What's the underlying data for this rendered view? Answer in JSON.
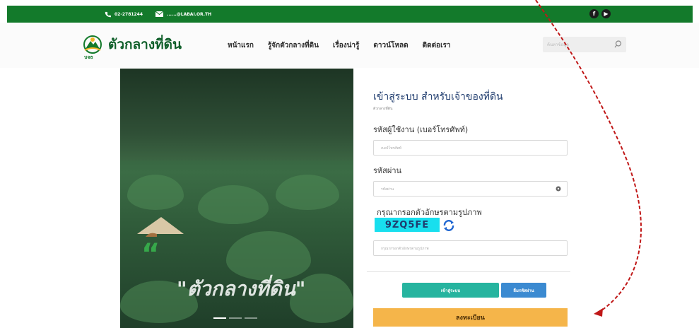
{
  "topbar": {
    "phone": "02-2781244",
    "email": "......@LABAI.OR.TH",
    "social": [
      "f",
      "▶"
    ]
  },
  "logo": {
    "name": "ตัวกลางที่ดิน",
    "abbr": "บจธ"
  },
  "nav": [
    "หน้าแรก",
    "รู้จักตัวกลางที่ดิน",
    "เรื่องน่ารู้",
    "ดาวน์โหลด",
    "ติดต่อเรา"
  ],
  "search": {
    "placeholder": "ค้นหาข้อมูล"
  },
  "hero": {
    "quote_mark": "“",
    "caption": "\"ตัวกลางที่ดิน\""
  },
  "form": {
    "title": "เข้าสู่ระบบ สำหรับเจ้าของที่ดิน",
    "subtitle": "ตัวกลางที่ดิน",
    "username_label": "รหัสผู้ใช้งาน (เบอร์โทรศัพท์)",
    "username_placeholder": "เบอร์โทรศัพท์",
    "password_label": "รหัสผ่าน",
    "password_placeholder": "รหัสผ่าน",
    "captcha_label": "กรุณากรอกตัวอักษรตามรูปภาพ",
    "captcha_code": "9ZQ5FE",
    "captcha_placeholder": "กรุณากรอกตัวอักษรตามรูปภาพ",
    "login_button": "เข้าสู่ระบบ",
    "forgot_button": "ลืมรหัสผ่าน",
    "register_button": "ลงทะเบียน"
  },
  "colors": {
    "topbar": "#137a2b",
    "title": "#1f3c6e",
    "login": "#26b49f",
    "forgot": "#3b8ad1",
    "register": "#f5b54a",
    "captcha": "#18dfee",
    "annotation_arrow": "#c01818"
  },
  "icons": {
    "phone": "phone-icon",
    "email": "mail-icon",
    "search": "search-icon",
    "eye": "eye-icon",
    "refresh": "refresh-icon"
  }
}
